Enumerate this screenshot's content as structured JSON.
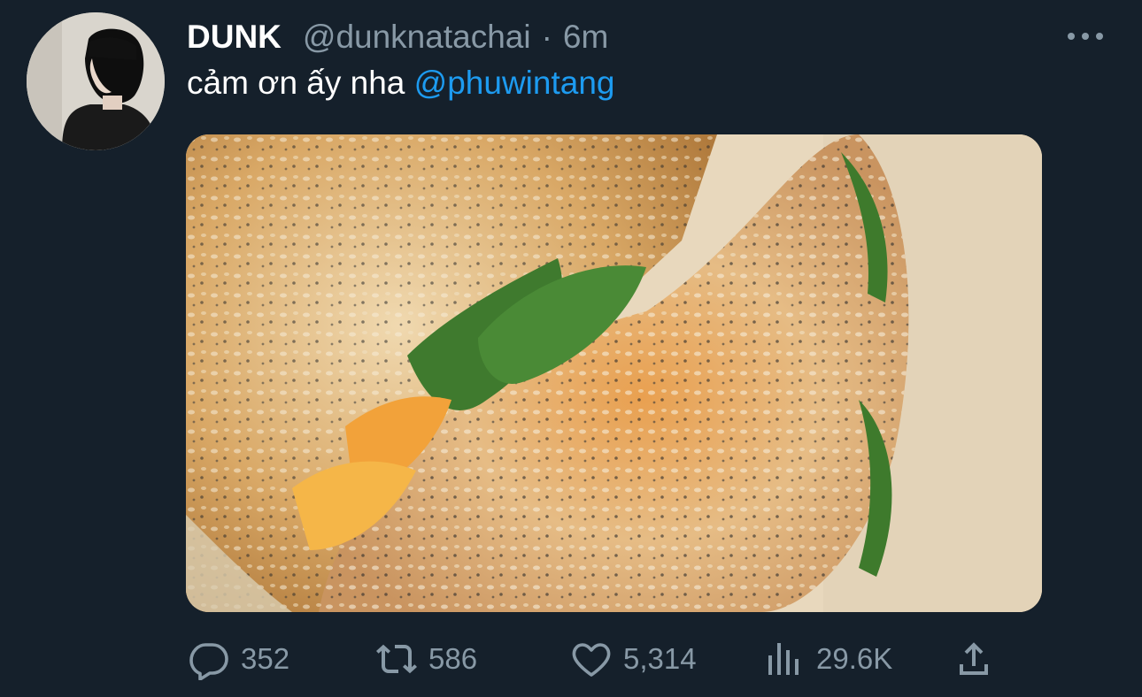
{
  "tweet": {
    "author": {
      "display_name": "DUNK",
      "handle": "@dunknatachai",
      "separator": "·",
      "time": "6m",
      "avatar_icon": "profile-photo"
    },
    "text_prefix": "cảm ơn ấy nha ",
    "mention": "@phuwintang",
    "media": {
      "description_icon": "bagel-sandwich-photo"
    },
    "actions": {
      "replies": "352",
      "retweets": "586",
      "likes": "5,314",
      "views": "29.6K"
    }
  },
  "colors": {
    "background": "#15202b",
    "secondary_text": "#8899a6",
    "link": "#1d9bf0"
  }
}
